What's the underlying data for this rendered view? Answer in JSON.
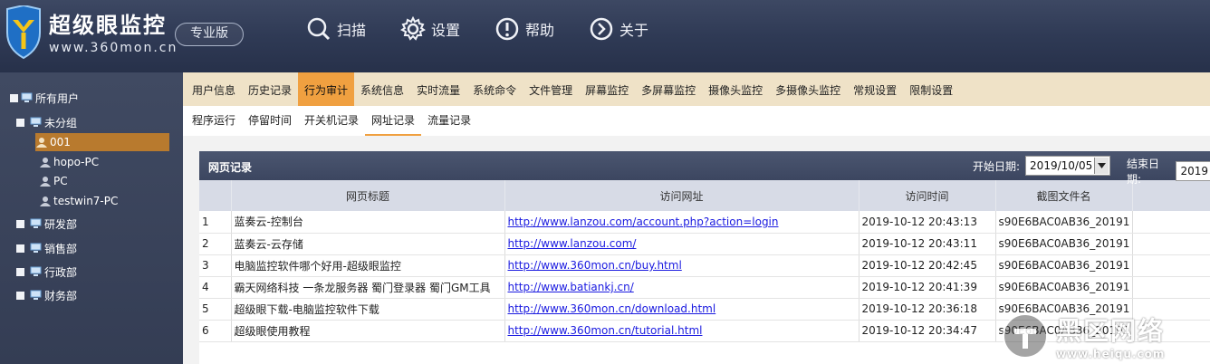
{
  "app": {
    "brand_cn": "超级眼监控",
    "brand_url": "www.360mon.cn",
    "edition": "专业版",
    "colors": {
      "header": "#2f3a55",
      "accent": "#f0a040",
      "selected_node": "#b87a2e"
    }
  },
  "topmenu": [
    {
      "label": "扫描",
      "icon": "search-icon"
    },
    {
      "label": "设置",
      "icon": "gear-icon"
    },
    {
      "label": "帮助",
      "icon": "help-icon"
    },
    {
      "label": "关于",
      "icon": "about-arrow-icon"
    }
  ],
  "tree": {
    "root": "所有用户",
    "groups": [
      {
        "label": "未分组",
        "children": [
          "001",
          "hopo-PC",
          "PC",
          "testwin7-PC"
        ],
        "selected_child": "001"
      },
      {
        "label": "研发部"
      },
      {
        "label": "销售部"
      },
      {
        "label": "行政部"
      },
      {
        "label": "财务部"
      }
    ]
  },
  "tabs_main": [
    "用户信息",
    "历史记录",
    "行为审计",
    "系统信息",
    "实时流量",
    "系统命令",
    "文件管理",
    "屏幕监控",
    "多屏幕监控",
    "摄像头监控",
    "多摄像头监控",
    "常规设置",
    "限制设置"
  ],
  "tabs_main_active": "行为审计",
  "tabs_sub": [
    "程序运行",
    "停留时间",
    "开关机记录",
    "网址记录",
    "流量记录"
  ],
  "tabs_sub_active": "网址记录",
  "panel": {
    "title": "网页记录",
    "start_label": "开始日期:",
    "start_value": "2019/10/05",
    "end_label": "结束日期:",
    "end_value": "2019"
  },
  "table": {
    "headers": [
      "",
      "网页标题",
      "访问网址",
      "访问时间",
      "截图文件名"
    ],
    "rows": [
      {
        "n": "1",
        "title": "蓝奏云-控制台",
        "url": "http://www.lanzou.com/account.php?action=login",
        "time": "2019-10-12 20:43:13",
        "file": "s90E6BAC0AB36_20191"
      },
      {
        "n": "2",
        "title": "蓝奏云-云存储",
        "url": "http://www.lanzou.com/",
        "time": "2019-10-12 20:43:11",
        "file": "s90E6BAC0AB36_20191"
      },
      {
        "n": "3",
        "title": "电脑监控软件哪个好用-超级眼监控",
        "url": "http://www.360mon.cn/buy.html",
        "time": "2019-10-12 20:42:45",
        "file": "s90E6BAC0AB36_20191"
      },
      {
        "n": "4",
        "title": "霸天网络科技 一条龙服务器 蜀门登录器 蜀门GM工具",
        "url": "http://www.batiankj.cn/",
        "time": "2019-10-12 20:41:39",
        "file": "s90E6BAC0AB36_20191"
      },
      {
        "n": "5",
        "title": "超级眼下载-电脑监控软件下载",
        "url": "http://www.360mon.cn/download.html",
        "time": "2019-10-12 20:36:18",
        "file": "s90E6BAC0AB36_20191"
      },
      {
        "n": "6",
        "title": "超级眼使用教程",
        "url": "http://www.360mon.cn/tutorial.html",
        "time": "2019-10-12 20:34:47",
        "file": "s90E6BAC0AB36_20191"
      }
    ]
  },
  "watermark": {
    "big": "黑区网络",
    "small": "www.heiqu.com"
  }
}
